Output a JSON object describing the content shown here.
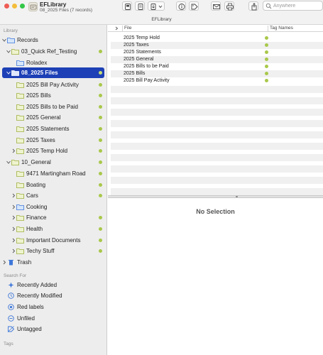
{
  "window": {
    "title": "EFLibrary",
    "subtitle": "08_2025 Files (7 records)",
    "library_name": "EFLibrary"
  },
  "toolbar": {
    "search_placeholder": "Anywhere"
  },
  "sidebar": {
    "library_label": "Library",
    "records": "Records",
    "quick_ref": "03_Quick Ref_Testing",
    "roladex": "Roladex",
    "files_2025": "08_2025 Files",
    "bill_pay_activity": "2025 Bill Pay Activity",
    "bills": "2025 Bills",
    "bills_to_be_paid": "2025 Bills to be Paid",
    "general_2025": "2025 General",
    "statements": "2025 Statements",
    "taxes": "2025 Taxes",
    "temp_hold": "2025 Temp Hold",
    "general": "10_General",
    "martingham": "9471 Martingham Road",
    "boating": "Boating",
    "cars": "Cars",
    "cooking": "Cooking",
    "finance": "Finance",
    "health": "Health",
    "important_docs": "Important Documents",
    "techy_stuff": "Techy Stuff",
    "trash": "Trash",
    "search_for_label": "Search For",
    "recently_added": "Recently Added",
    "recently_modified": "Recently Modified",
    "red_labels": "Red labels",
    "unfiled": "Unfiled",
    "untagged": "Untagged",
    "tags_label": "Tags",
    "tag_color": "#a9c84a",
    "selection_color": "#1d40b6"
  },
  "table": {
    "col_file": "File",
    "col_tags": "Tag Names",
    "rows": [
      "2025 Temp Hold",
      "2025 Taxes",
      "2025 Statements",
      "2025 General",
      "2025 Bills to be Paid",
      "2025 Bills",
      "2025 Bill Pay Activity"
    ]
  },
  "preview": {
    "no_selection": "No Selection"
  }
}
